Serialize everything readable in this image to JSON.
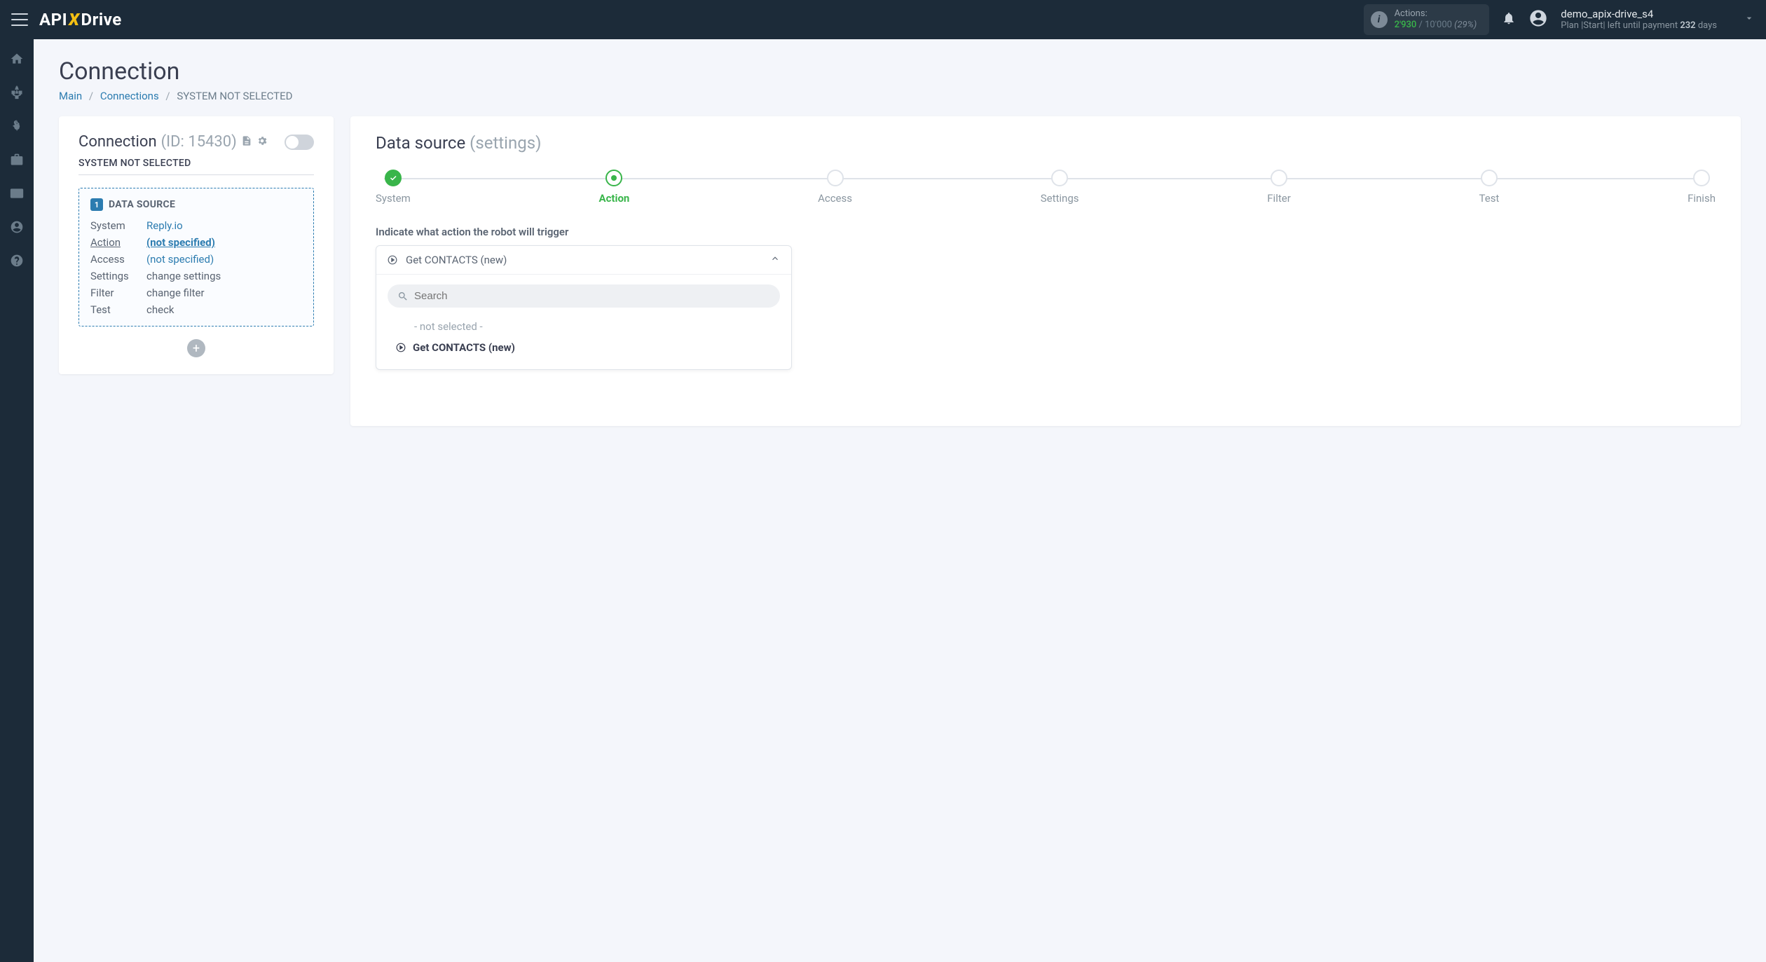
{
  "header": {
    "logo": {
      "left": "API",
      "x": "X",
      "right": "Drive"
    },
    "actions": {
      "label": "Actions:",
      "current": "2'930",
      "max": "10'000",
      "percent": "(29%)"
    },
    "user": {
      "name": "demo_apix-drive_s4",
      "plan_prefix": "Plan |Start| left until payment ",
      "days": "232",
      "days_suffix": " days"
    }
  },
  "page": {
    "title": "Connection",
    "breadcrumb": {
      "main": "Main",
      "connections": "Connections",
      "current": "SYSTEM NOT SELECTED"
    }
  },
  "left": {
    "title": "Connection",
    "id_label": "(ID: 15430)",
    "sys_not_sel": "SYSTEM NOT SELECTED",
    "ds_badge": "1",
    "ds_title": "DATA SOURCE",
    "rows": {
      "system_k": "System",
      "system_v": "Reply.io",
      "action_k": "Action",
      "action_v": "(not specified)",
      "access_k": "Access",
      "access_v": "(not specified)",
      "settings_k": "Settings",
      "settings_v": "change settings",
      "filter_k": "Filter",
      "filter_v": "change filter",
      "test_k": "Test",
      "test_v": "check"
    }
  },
  "right": {
    "title": "Data source",
    "subtitle": "(settings)",
    "steps": [
      "System",
      "Action",
      "Access",
      "Settings",
      "Filter",
      "Test",
      "Finish"
    ],
    "instruction": "Indicate what action the robot will trigger",
    "select": {
      "value": "Get CONTACTS (new)",
      "search_placeholder": "Search",
      "opt_not_selected": "- not selected -",
      "opt_get_contacts": "Get CONTACTS (new)"
    }
  }
}
